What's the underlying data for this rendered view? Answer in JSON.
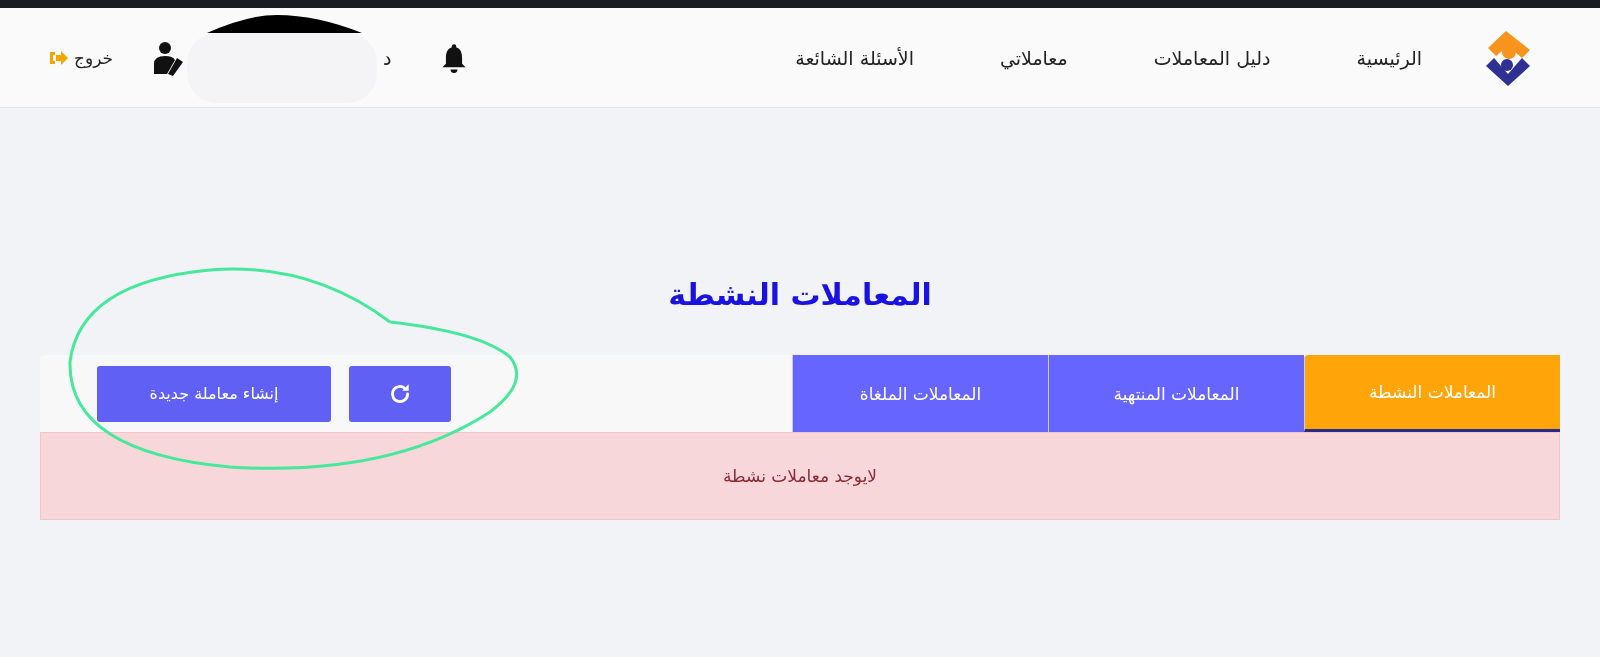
{
  "header": {
    "nav": [
      {
        "label": "الرئيسية"
      },
      {
        "label": "دليل المعاملات"
      },
      {
        "label": "معاملاتي"
      },
      {
        "label": "الأسئلة الشائعة"
      }
    ],
    "user_name": "د",
    "logout": "خروج"
  },
  "title": "المعاملات النشطة",
  "tabs": [
    {
      "label": "المعاملات النشطة",
      "selected": true
    },
    {
      "label": "المعاملات المنتهية",
      "selected": false
    },
    {
      "label": "المعاملات الملغاة",
      "selected": false
    }
  ],
  "create_button": "إنشاء معاملة جديدة",
  "alert": "لايوجد معاملات نشطة"
}
